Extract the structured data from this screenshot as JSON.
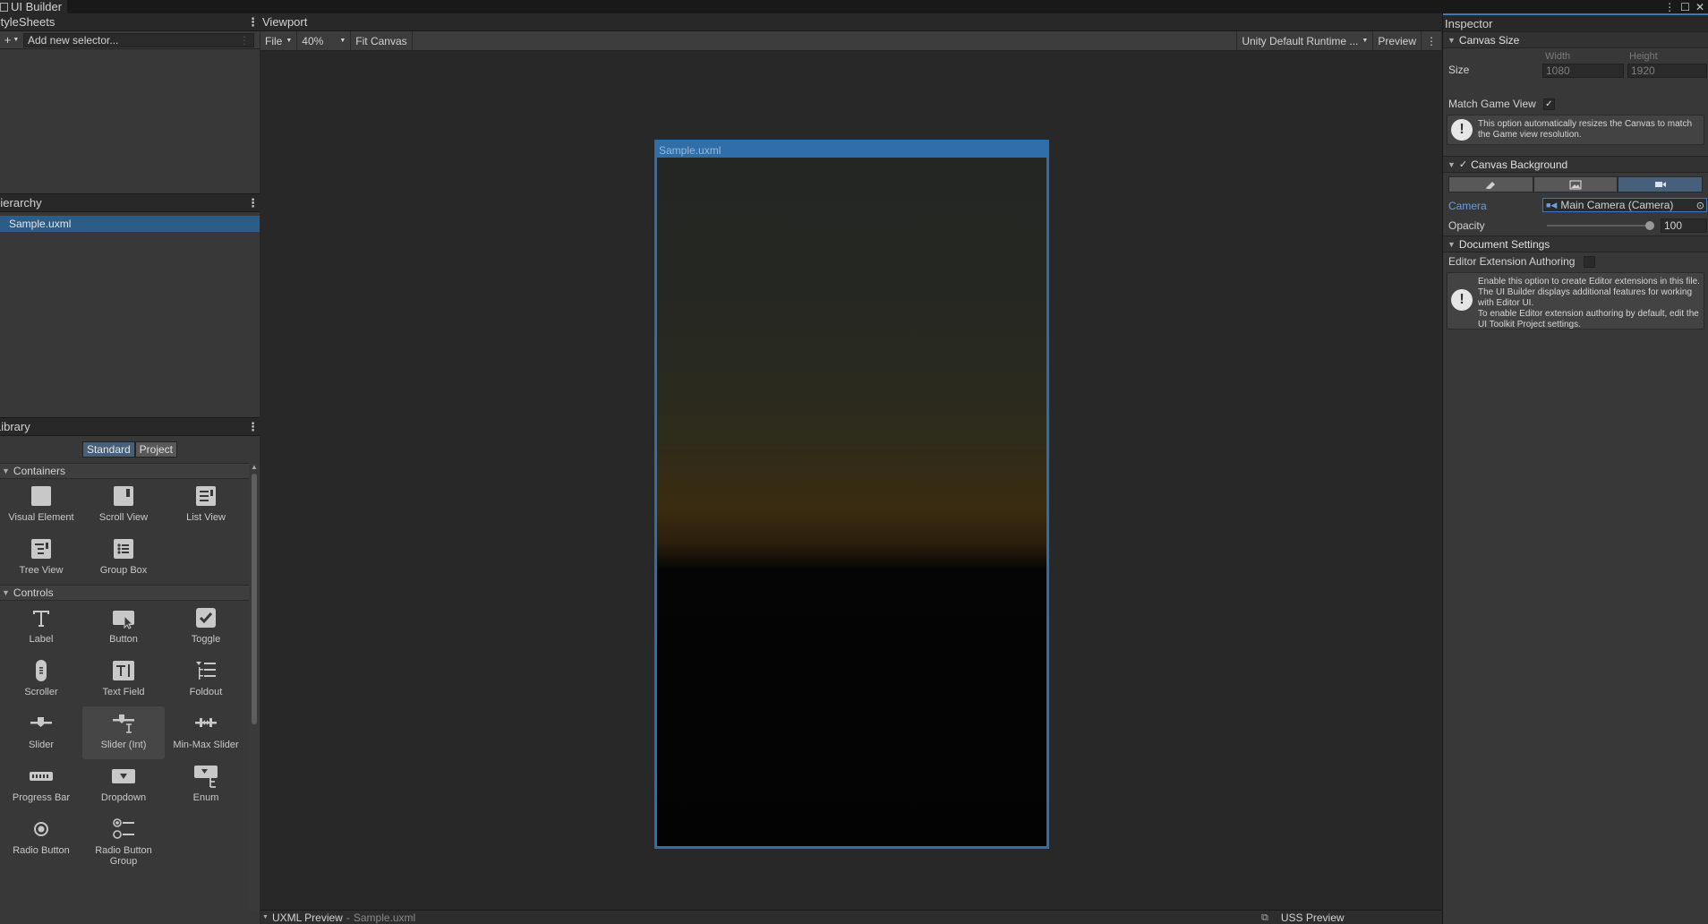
{
  "window": {
    "title": "UI Builder"
  },
  "stylesheets": {
    "title": "StyleSheets",
    "selector_placeholder": "Add new selector..."
  },
  "hierarchy": {
    "title": "Hierarchy",
    "items": [
      {
        "label": "Sample.uxml"
      }
    ]
  },
  "library": {
    "title": "Library",
    "tabs": {
      "standard": "Standard",
      "project": "Project"
    },
    "categories": {
      "containers": {
        "label": "Containers",
        "items": [
          {
            "label": "Visual Element",
            "icon": "visual-element-icon"
          },
          {
            "label": "Scroll View",
            "icon": "scroll-view-icon"
          },
          {
            "label": "List View",
            "icon": "list-view-icon"
          },
          {
            "label": "Tree View",
            "icon": "tree-view-icon"
          },
          {
            "label": "Group Box",
            "icon": "group-box-icon"
          }
        ]
      },
      "controls": {
        "label": "Controls",
        "items": [
          {
            "label": "Label",
            "icon": "label-icon"
          },
          {
            "label": "Button",
            "icon": "button-icon"
          },
          {
            "label": "Toggle",
            "icon": "toggle-icon"
          },
          {
            "label": "Scroller",
            "icon": "scroller-icon"
          },
          {
            "label": "Text Field",
            "icon": "text-field-icon"
          },
          {
            "label": "Foldout",
            "icon": "foldout-icon"
          },
          {
            "label": "Slider",
            "icon": "slider-icon"
          },
          {
            "label": "Slider (Int)",
            "icon": "slider-int-icon"
          },
          {
            "label": "Min-Max Slider",
            "icon": "min-max-slider-icon"
          },
          {
            "label": "Progress Bar",
            "icon": "progress-bar-icon"
          },
          {
            "label": "Dropdown",
            "icon": "dropdown-icon"
          },
          {
            "label": "Enum",
            "icon": "enum-icon"
          },
          {
            "label": "Radio Button",
            "icon": "radio-button-icon"
          },
          {
            "label": "Radio Button Group",
            "icon": "radio-button-group-icon"
          }
        ]
      }
    }
  },
  "viewport": {
    "title": "Viewport",
    "file_menu": "File",
    "zoom": "40%",
    "fit_canvas": "Fit Canvas",
    "theme": "Unity Default Runtime ...",
    "preview": "Preview",
    "canvas_title": "Sample.uxml"
  },
  "bottom": {
    "uxml_preview": "UXML Preview",
    "separator": "-",
    "uxml_file": "Sample.uxml",
    "uss_preview": "USS Preview"
  },
  "inspector": {
    "title": "Inspector",
    "canvas_size": {
      "label": "Canvas Size",
      "size_label": "Size",
      "width_label": "Width",
      "height_label": "Height",
      "width": "1080",
      "height": "1920",
      "match_game_view": "Match Game View",
      "match_game_view_checked": "✓",
      "help": "This option automatically resizes the Canvas to match the Game view resolution."
    },
    "canvas_background": {
      "label": "Canvas Background",
      "checked": "✓",
      "camera_label": "Camera",
      "camera_value": "Main Camera (Camera)",
      "opacity_label": "Opacity",
      "opacity_value": "100",
      "opacity_percent": 100
    },
    "document_settings": {
      "label": "Document Settings",
      "editor_extension": "Editor Extension Authoring",
      "help_line1": "Enable this option to create Editor extensions in this file. The UI Builder displays additional features for working with Editor UI.",
      "help_line2": "To enable Editor extension authoring by default, edit the UI Toolkit Project settings."
    }
  },
  "colors": {
    "accent": "#2f6ea8",
    "selection": "#2c5d87",
    "panel": "#383838",
    "viewport_bg": "#282828",
    "camera_label": "#6a9fdb"
  }
}
